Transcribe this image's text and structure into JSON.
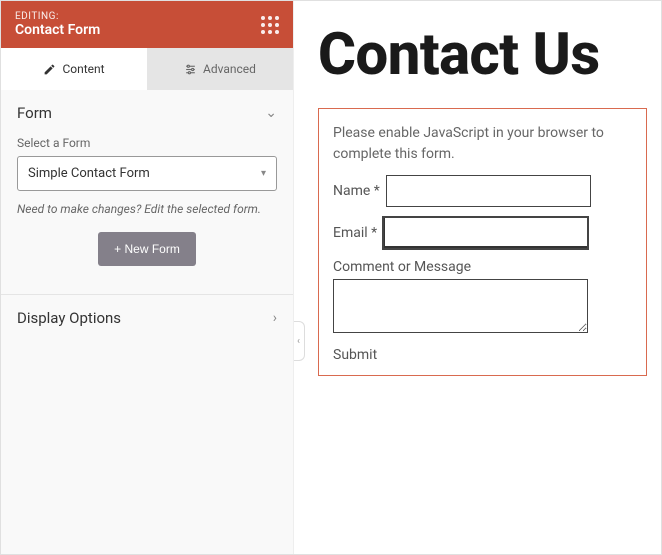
{
  "header": {
    "label": "EDITING:",
    "title": "Contact Form"
  },
  "tabs": {
    "content": "Content",
    "advanced": "Advanced"
  },
  "form_section": {
    "title": "Form",
    "select_label": "Select a Form",
    "selected": "Simple Contact Form",
    "help": "Need to make changes? Edit the selected form.",
    "new_button": "+ New Form"
  },
  "display_section": {
    "title": "Display Options"
  },
  "preview": {
    "heading": "Contact Us",
    "notice": "Please enable JavaScript in your browser to complete this form.",
    "name_label": "Name",
    "email_label": "Email",
    "required": "*",
    "comment_label": "Comment or Message",
    "submit": "Submit"
  }
}
